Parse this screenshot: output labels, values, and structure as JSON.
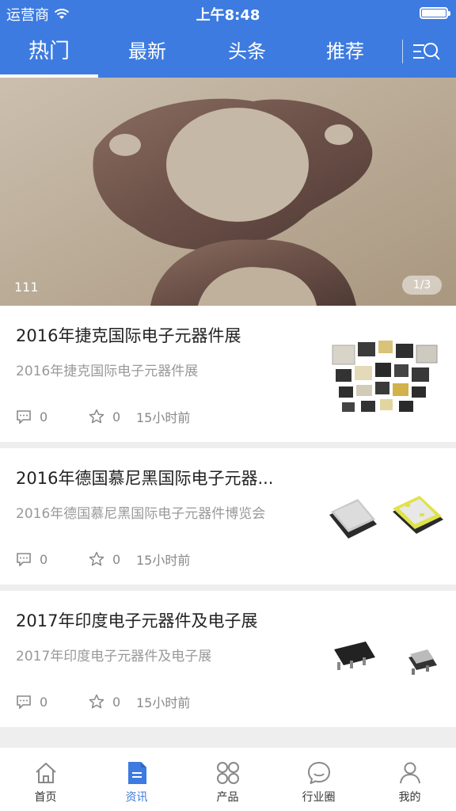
{
  "status_bar": {
    "carrier": "运营商",
    "time": "上午8:48"
  },
  "tabs": [
    {
      "label": "热门",
      "active": true
    },
    {
      "label": "最新",
      "active": false
    },
    {
      "label": "头条",
      "active": false
    },
    {
      "label": "推荐",
      "active": false
    }
  ],
  "search_icon": "search-list-icon",
  "banner": {
    "caption": "111",
    "indicator": "1/3"
  },
  "news": [
    {
      "title": "2016年捷克国际电子元器件展",
      "summary": "2016年捷克国际电子元器件展",
      "comments": "0",
      "favorites": "0",
      "time": "15小时前"
    },
    {
      "title": "2016年德国慕尼黑国际电子元器...",
      "summary": "2016年德国慕尼黑国际电子元器件博览会",
      "comments": "0",
      "favorites": "0",
      "time": "15小时前"
    },
    {
      "title": "2017年印度电子元器件及电子展",
      "summary": "2017年印度电子元器件及电子展",
      "comments": "0",
      "favorites": "0",
      "time": "15小时前"
    }
  ],
  "bottom_nav": [
    {
      "label": "首页",
      "icon": "home-icon",
      "active": false
    },
    {
      "label": "资讯",
      "icon": "document-icon",
      "active": true
    },
    {
      "label": "产品",
      "icon": "grid-icon",
      "active": false
    },
    {
      "label": "行业圈",
      "icon": "chat-bubble-icon",
      "active": false
    },
    {
      "label": "我的",
      "icon": "person-icon",
      "active": false
    }
  ],
  "colors": {
    "accent": "#3d7be0",
    "inactive_icon": "#888888"
  }
}
